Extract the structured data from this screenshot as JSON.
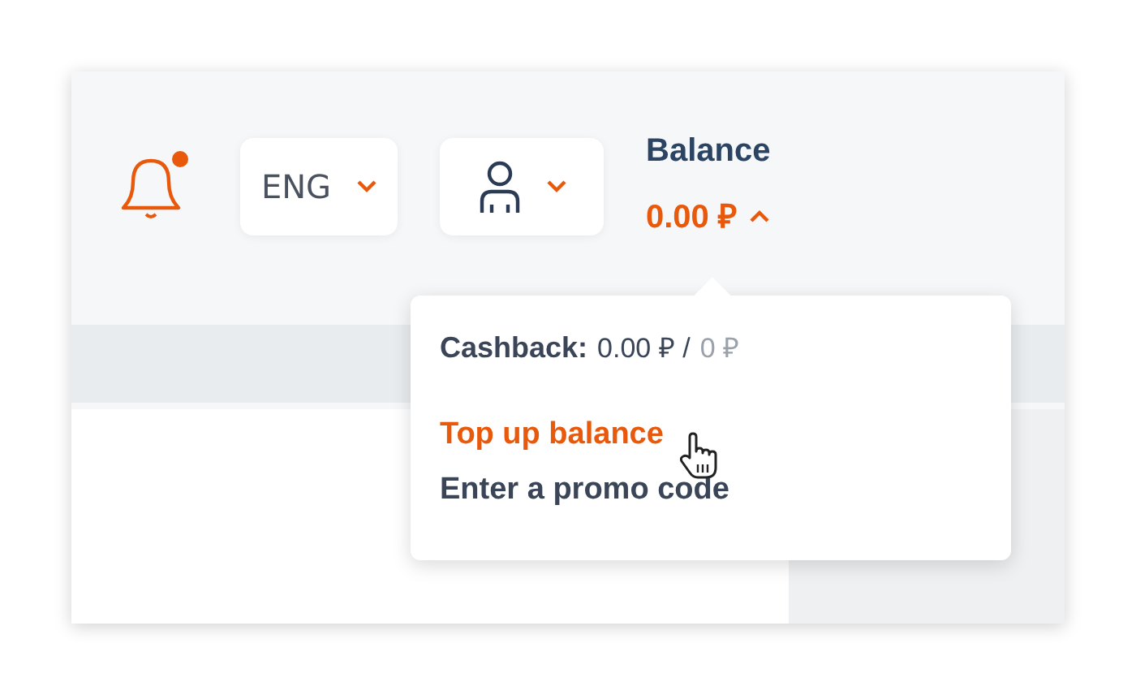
{
  "header": {
    "notifications": {
      "unread": true
    },
    "language": {
      "label": "ENG"
    },
    "balance": {
      "label": "Balance",
      "amount": "0.00 ₽",
      "expanded": true
    }
  },
  "balance_menu": {
    "cashback": {
      "label": "Cashback:",
      "value": "0.00 ₽ /",
      "limit": "0 ₽"
    },
    "items": [
      {
        "label": "Top up balance",
        "highlighted": true
      },
      {
        "label": "Enter a promo code",
        "highlighted": false
      }
    ]
  }
}
